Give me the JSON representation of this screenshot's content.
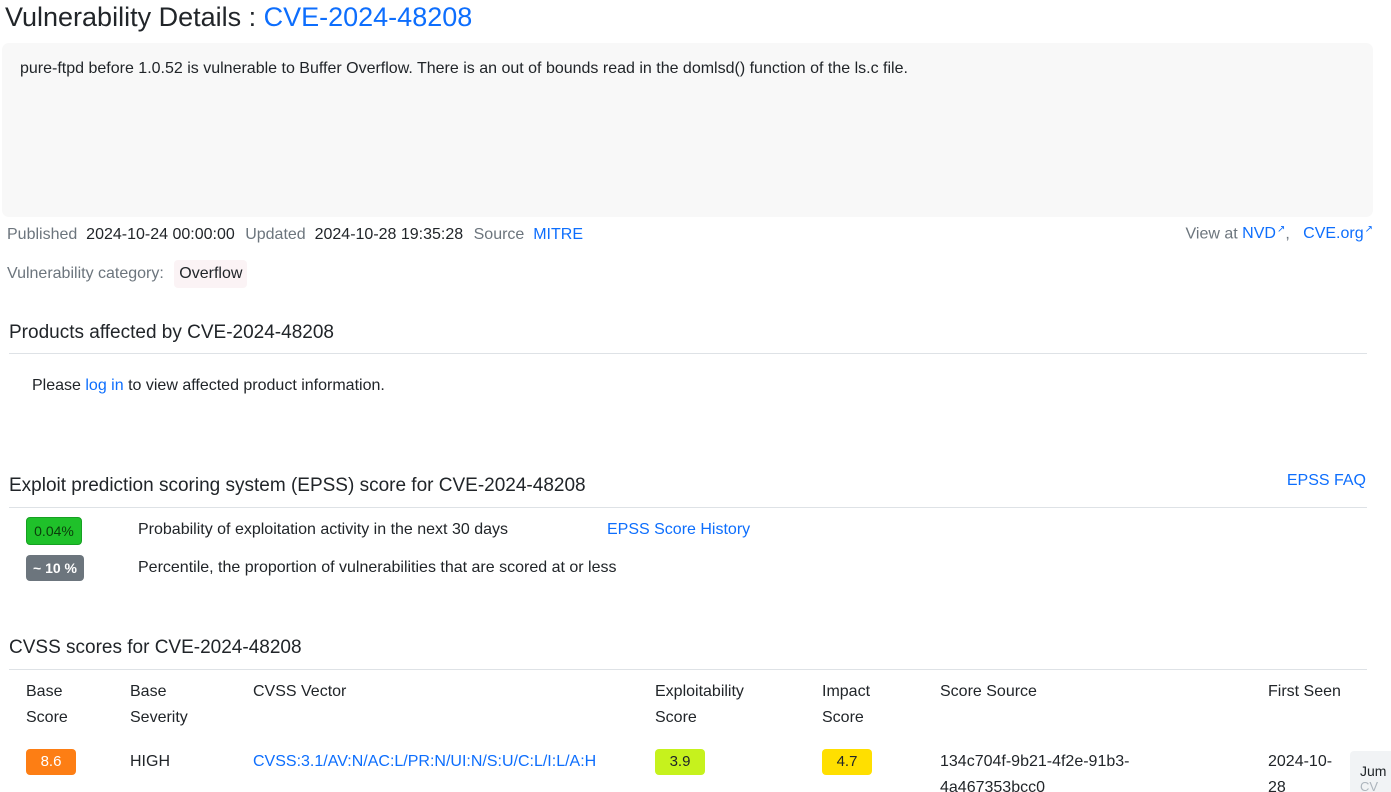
{
  "title": {
    "prefix": "Vulnerability Details : ",
    "cve_id": "CVE-2024-48208"
  },
  "description": "pure-ftpd before 1.0.52 is vulnerable to Buffer Overflow. There is an out of bounds read in the domlsd() function of the ls.c file.",
  "meta": {
    "published_label": "Published",
    "published_value": "2024-10-24 00:00:00",
    "updated_label": "Updated",
    "updated_value": "2024-10-28 19:35:28",
    "source_label": "Source",
    "source_value": "MITRE"
  },
  "view_at": {
    "label": "View at",
    "nvd": "NVD",
    "separator": ",",
    "cve_org": "CVE.org"
  },
  "category": {
    "label": "Vulnerability category:",
    "value": "Overflow"
  },
  "products": {
    "title": "Products affected by CVE-2024-48208",
    "msg_prefix": "Please",
    "login_link": "log in",
    "msg_suffix": "to view affected product information."
  },
  "epss": {
    "title": "Exploit prediction scoring system (EPSS) score for CVE-2024-48208",
    "faq_link": "EPSS FAQ",
    "probability_value": "0.04%",
    "probability_text": "Probability of exploitation activity in the next 30 days",
    "history_link": "EPSS Score History",
    "percentile_value": "~ 10 %",
    "percentile_text": "Percentile, the proportion of vulnerabilities that are scored at or less",
    "colors": {
      "probability": "#1fc12a",
      "percentile": "#6c757d"
    }
  },
  "cvss": {
    "title": "CVSS scores for CVE-2024-48208",
    "headers": {
      "base_score_1": "Base",
      "base_score_2": "Score",
      "base_severity_1": "Base",
      "base_severity_2": "Severity",
      "vector": "CVSS Vector",
      "exploitability_1": "Exploitability",
      "exploitability_2": "Score",
      "impact_1": "Impact",
      "impact_2": "Score",
      "score_source": "Score Source",
      "first_seen": "First Seen"
    },
    "rows": [
      {
        "base_score": "8.6",
        "base_severity": "HIGH",
        "vector": "CVSS:3.1/AV:N/AC:L/PR:N/UI:N/S:U/C:L/I:L/A:H",
        "exploitability": "3.9",
        "impact": "4.7",
        "score_source_1": "134c704f-9b21-4f2e-91b3-",
        "score_source_2": "4a467353bcc0",
        "first_seen_1": "2024-10-",
        "first_seen_2": "28"
      }
    ],
    "colors": {
      "base": "#fd7e14",
      "exploitability": "#c6f21d",
      "impact": "#ffdf00"
    }
  },
  "jump": {
    "label": "Jum",
    "sub": "CV"
  }
}
